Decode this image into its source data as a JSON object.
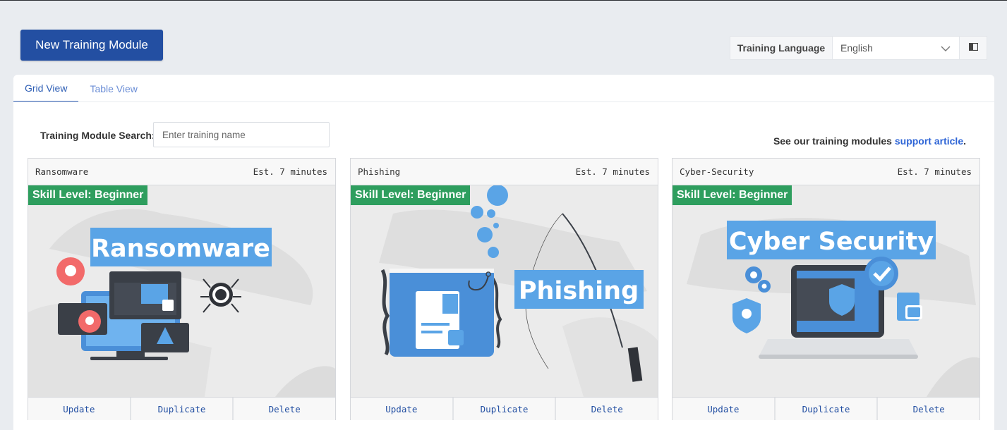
{
  "toolbar": {
    "new_module_label": "New Training Module",
    "language_label": "Training Language",
    "language_value": "English"
  },
  "tabs": [
    {
      "label": "Grid View",
      "active": true
    },
    {
      "label": "Table View",
      "active": false
    }
  ],
  "search": {
    "label": "Training Module Search:",
    "placeholder": "Enter training name"
  },
  "support": {
    "prefix": "See our training modules ",
    "link": "support article",
    "suffix": "."
  },
  "cards": [
    {
      "name": "Ransomware",
      "duration": "Est. 7 minutes",
      "skill": "Skill Level: Beginner",
      "image_title": "Ransomware",
      "actions": [
        "Update",
        "Duplicate",
        "Delete"
      ]
    },
    {
      "name": "Phishing",
      "duration": "Est. 7 minutes",
      "skill": "Skill Level: Beginner",
      "image_title": "Phishing",
      "actions": [
        "Update",
        "Duplicate",
        "Delete"
      ]
    },
    {
      "name": "Cyber-Security",
      "duration": "Est. 7 minutes",
      "skill": "Skill Level: Beginner",
      "image_title": "Cyber Security",
      "actions": [
        "Update",
        "Duplicate",
        "Delete"
      ]
    }
  ],
  "colors": {
    "primary": "#234fa2",
    "skill_badge": "#2e9e5e",
    "illustration_blue": "#5aa4e6",
    "link": "#2d64d6"
  }
}
